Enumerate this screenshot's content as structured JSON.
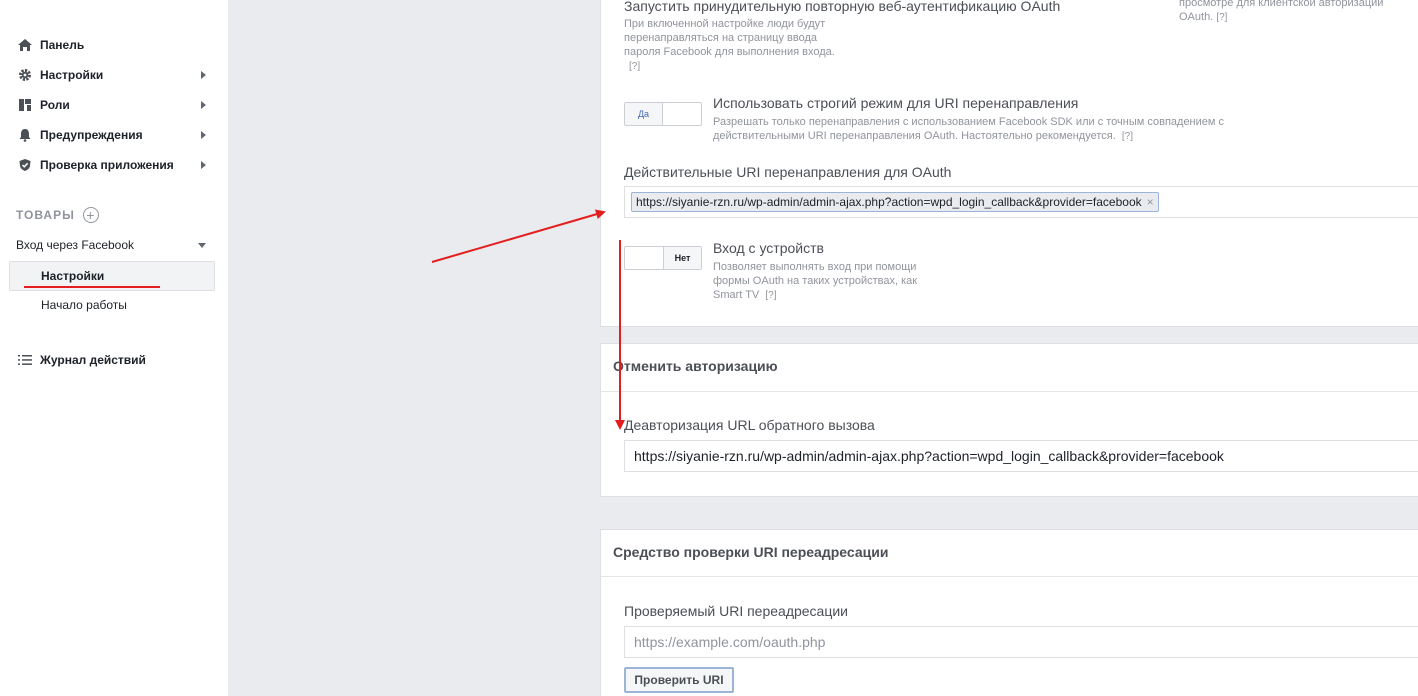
{
  "sidebar": {
    "items": [
      {
        "label": "Панель",
        "icon": "home-icon"
      },
      {
        "label": "Настройки",
        "icon": "gear-icon"
      },
      {
        "label": "Роли",
        "icon": "roles-icon"
      },
      {
        "label": "Предупреждения",
        "icon": "bell-icon"
      },
      {
        "label": "Проверка приложения",
        "icon": "shield-icon"
      }
    ],
    "products_heading": "ТОВАРЫ",
    "product_name": "Вход через Facebook",
    "product_subitems": [
      "Настройки",
      "Начало работы"
    ],
    "activity_log": "Журнал действий"
  },
  "card1": {
    "force_reauth_title": "Запустить принудительную повторную веб-аутентификацию OAuth",
    "force_reauth_desc_1": "При включенной настройке люди будут",
    "force_reauth_desc_2": "перенаправляться на страницу ввода",
    "force_reauth_desc_3": "пароля Facebook для выполнения входа.",
    "help": "[?]",
    "right_desc_1": "просмотре для клиентской авторизации",
    "right_desc_2": "OAuth.",
    "strict_toggle_label": "Да",
    "strict_title": "Использовать строгий режим для URI перенаправления",
    "strict_desc_1": "Разрешать только перенаправления с использованием Facebook SDK или с точным совпадением с",
    "strict_desc_2": "действительными URI перенаправления OAuth. Настоятельно рекомендуется.",
    "valid_uri_label": "Действительные URI перенаправления для OAuth",
    "valid_uri_token": "https://siyanie-rzn.ru/wp-admin/admin-ajax.php?action=wpd_login_callback&provider=facebook",
    "device_toggle_label": "Нет",
    "device_title": "Вход с устройств",
    "device_desc_1": "Позволяет выполнять вход при помощи",
    "device_desc_2": "формы OAuth на таких устройствах, как",
    "device_desc_3": "Smart TV"
  },
  "card2": {
    "heading": "Отменить авторизацию",
    "deauth_label": "Деавторизация URL обратного вызова",
    "deauth_value": "https://siyanie-rzn.ru/wp-admin/admin-ajax.php?action=wpd_login_callback&provider=facebook"
  },
  "card3": {
    "heading": "Средство проверки URI переадресации",
    "check_label": "Проверяемый URI переадресации",
    "check_placeholder": "https://example.com/oauth.php",
    "check_button": "Проверить URI"
  },
  "colors": {
    "accent": "#4267b2",
    "annotation_red": "#e41e1e",
    "background": "#e9ebee"
  }
}
